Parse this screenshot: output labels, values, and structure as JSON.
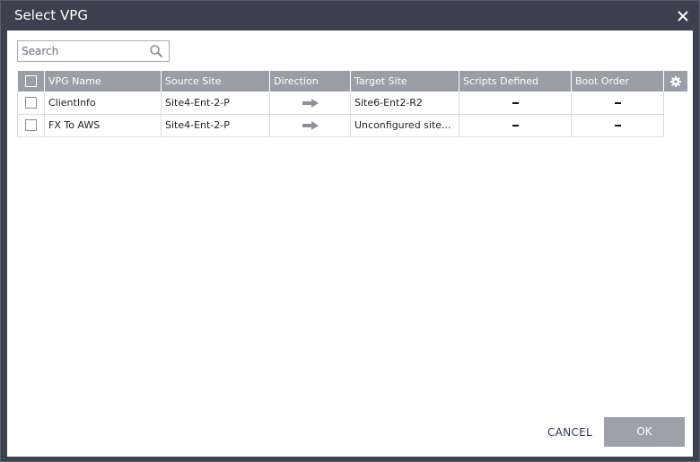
{
  "dialog": {
    "title": "Select VPG"
  },
  "search": {
    "placeholder": "Search"
  },
  "table": {
    "columns": [
      "VPG Name",
      "Source Site",
      "Direction",
      "Target Site",
      "Scripts Defined",
      "Boot Order"
    ],
    "rows": [
      {
        "vpg_name": "ClientInfo",
        "source_site": "Site4-Ent-2-P",
        "direction": "right-arrow-icon",
        "target_site": "Site6-Ent2-R2",
        "scripts_defined": "–",
        "boot_order": "–"
      },
      {
        "vpg_name": "FX To AWS",
        "source_site": "Site4-Ent-2-P",
        "direction": "right-arrow-icon",
        "target_site": "Unconfigured site...",
        "scripts_defined": "–",
        "boot_order": "–"
      }
    ]
  },
  "footer": {
    "cancel_label": "CANCEL",
    "ok_label": "OK"
  },
  "colors": {
    "titlebar": "#3c4150",
    "header": "#9a9ea7",
    "ok_button": "#9da1aa",
    "cancel_text": "#2b3a55"
  }
}
